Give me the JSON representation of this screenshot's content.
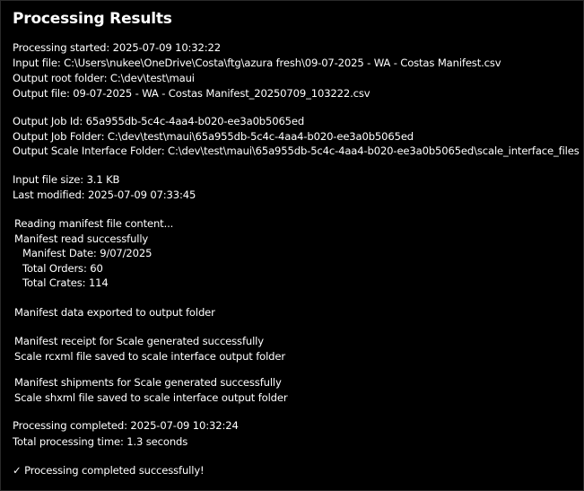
{
  "title": "Processing Results",
  "info": {
    "processing_started": "Processing started: 2025-07-09 10:32:22",
    "input_file": "Input file: C:\\Users\\nukee\\OneDrive\\Costa\\ftg\\azura fresh\\09-07-2025 - WA - Costas Manifest.csv",
    "output_root": "Output root folder: C:\\dev\\test\\maui",
    "output_file": "Output file: 09-07-2025 - WA - Costas Manifest_20250709_103222.csv"
  },
  "job": {
    "job_id": "Output Job Id: 65a955db-5c4c-4aa4-b020-ee3a0b5065ed",
    "job_folder": "Output Job Folder: C:\\dev\\test\\maui\\65a955db-5c4c-4aa4-b020-ee3a0b5065ed",
    "scale_folder": "Output Scale Interface Folder: C:\\dev\\test\\maui\\65a955db-5c4c-4aa4-b020-ee3a0b5065ed\\scale_interface_files"
  },
  "file": {
    "size": "Input file size: 3.1 KB",
    "modified": "Last modified: 2025-07-09 07:33:45"
  },
  "manifest": {
    "reading": "Reading manifest file content...",
    "read_ok": "Manifest read successfully",
    "date": "Manifest Date: 9/07/2025",
    "orders": "Total Orders: 60",
    "crates": "Total Crates: 114",
    "exported": "Manifest data exported to output folder",
    "receipt": "Manifest receipt for Scale generated successfully",
    "rcxml": "Scale rcxml file saved to scale interface output folder",
    "shipments": "Manifest shipments for Scale generated successfully",
    "shxml": "Scale shxml file saved to scale interface output folder"
  },
  "completion": {
    "completed": "Processing completed: 2025-07-09 10:32:24",
    "total_time": "Total processing time: 1.3 seconds",
    "success": "✓ Processing completed successfully!"
  }
}
